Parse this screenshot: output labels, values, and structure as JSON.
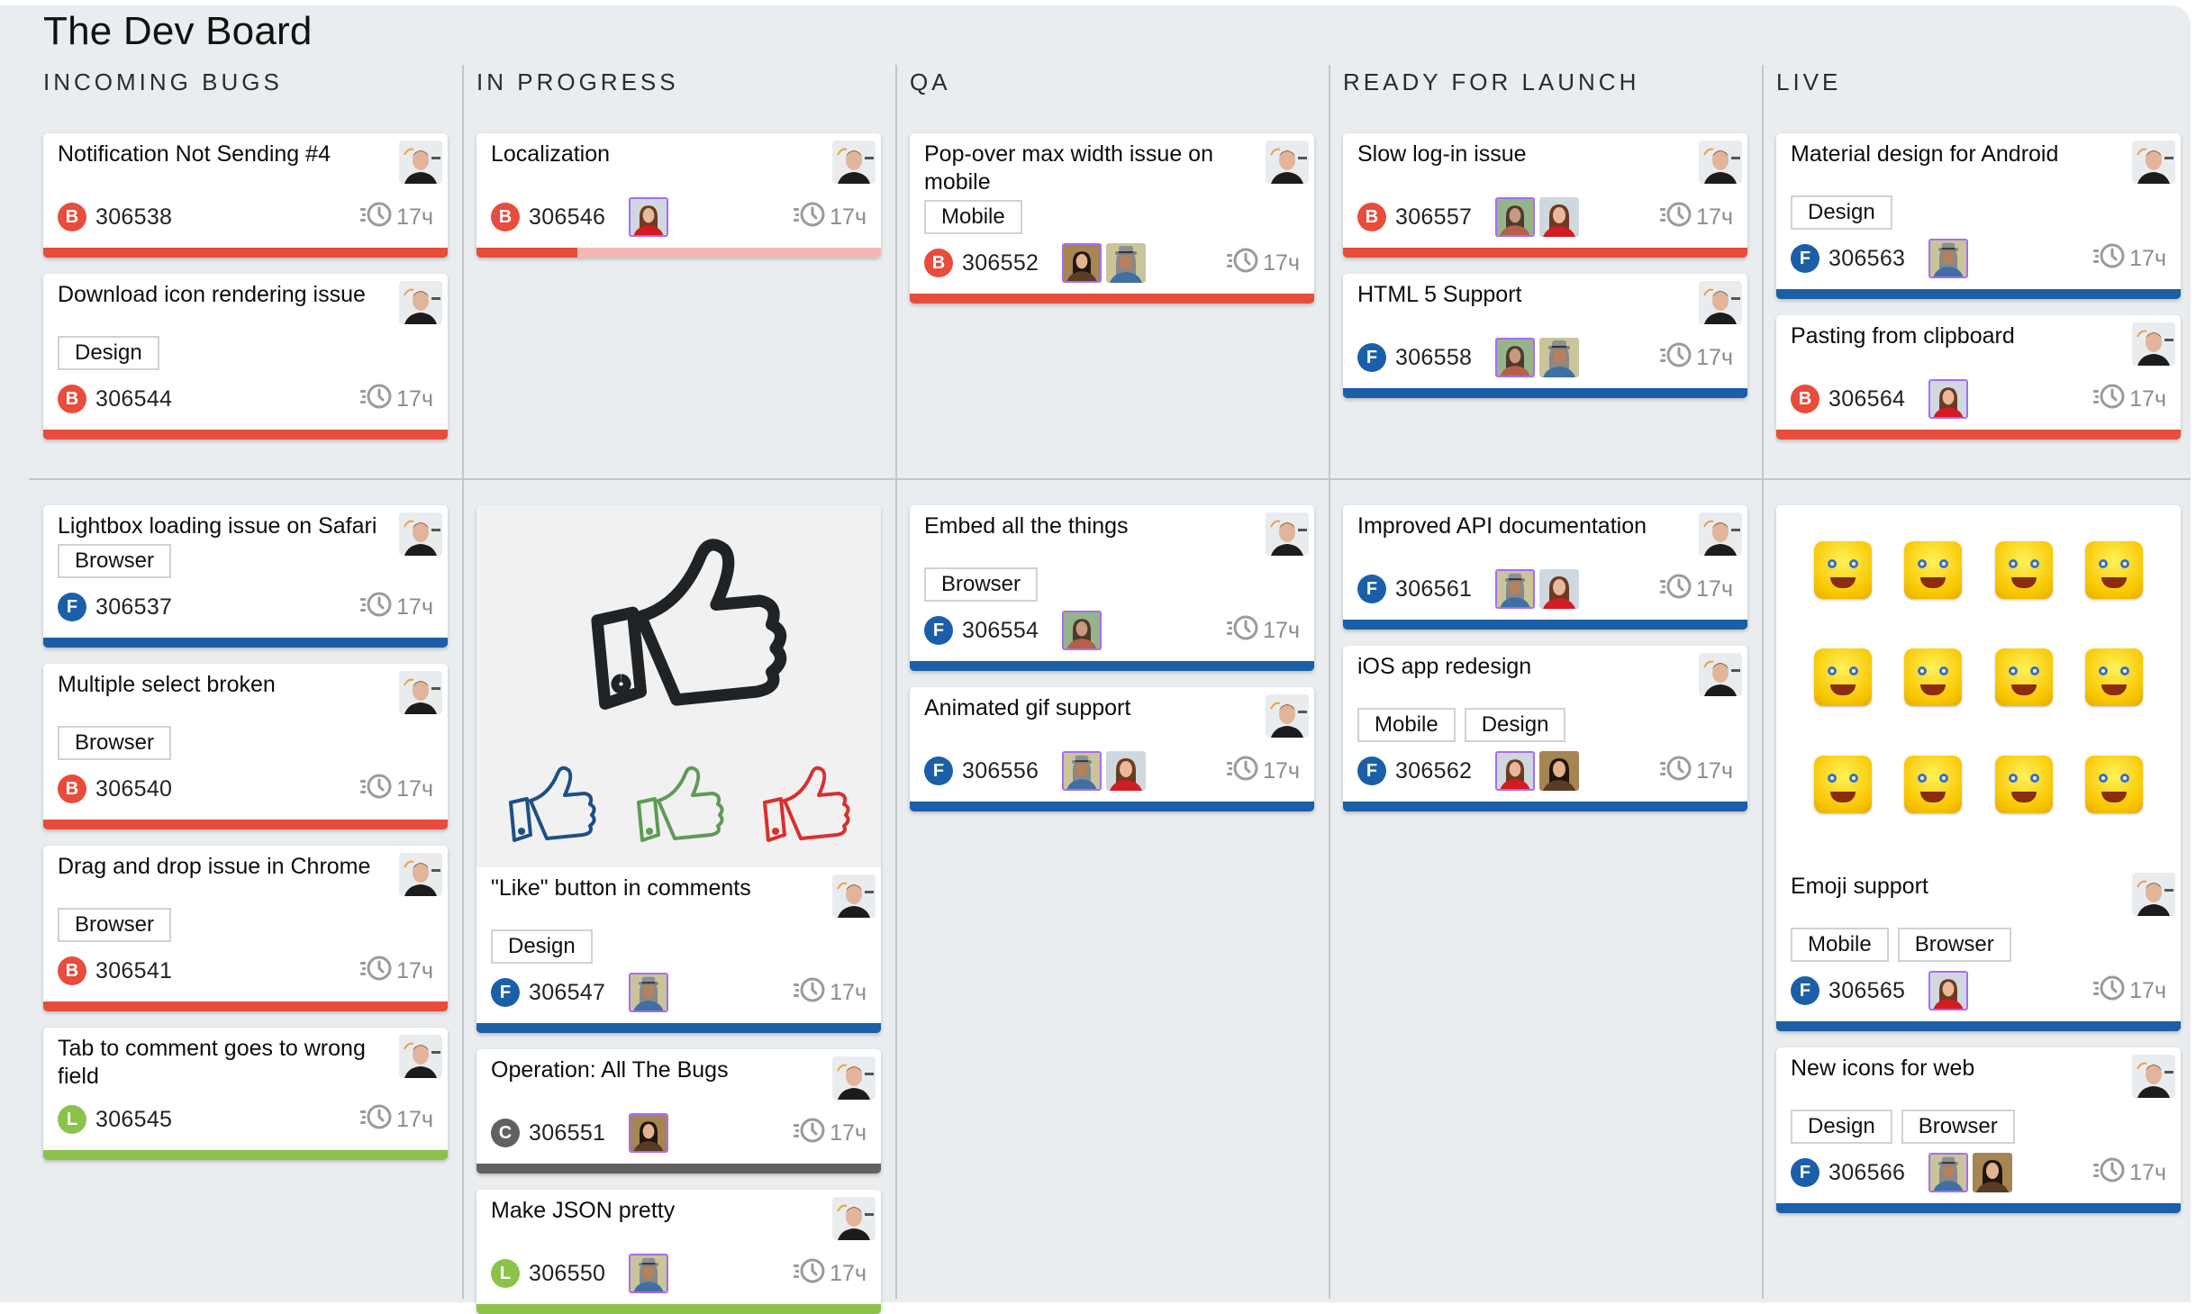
{
  "board": {
    "title": "The Dev Board",
    "colors": {
      "bug": "#e74c3c",
      "feature": "#1a5fa8",
      "chore": "#616161",
      "low": "#8bc34a",
      "progress_track_bug": "#f5b7b1",
      "member_highlight": "#a86cf5"
    }
  },
  "columns": [
    {
      "label": "INCOMING BUGS"
    },
    {
      "label": "IN PROGRESS"
    },
    {
      "label": "QA"
    },
    {
      "label": "READY FOR LAUNCH"
    },
    {
      "label": "LIVE"
    }
  ],
  "lanes": [
    {
      "columns": [
        [
          {
            "title": "Notification Not Sending #4",
            "tags": [],
            "type": "B",
            "type_color": "#e74c3c",
            "id": "306538",
            "members": [],
            "time": "17ч",
            "bar_color": "#e74c3c"
          },
          {
            "title": "Download icon rendering issue",
            "tags": [
              "Design"
            ],
            "type": "B",
            "type_color": "#e74c3c",
            "id": "306544",
            "members": [],
            "time": "17ч",
            "bar_color": "#e74c3c"
          }
        ],
        [
          {
            "title": "Localization",
            "tags": [],
            "type": "B",
            "type_color": "#e74c3c",
            "id": "306546",
            "members": [
              "woman-red"
            ],
            "time": "17ч",
            "bar_color": "#e74c3c",
            "progress": 0.25,
            "bar_track": "#f5b7b1"
          }
        ],
        [
          {
            "title": "Pop-over max width issue on mobile",
            "tags": [
              "Mobile"
            ],
            "type": "B",
            "type_color": "#e74c3c",
            "id": "306552",
            "members": [
              "woman-dark-hair",
              "man-hat"
            ],
            "time": "17ч",
            "bar_color": "#e74c3c"
          }
        ],
        [
          {
            "title": "Slow log-in issue",
            "tags": [],
            "type": "B",
            "type_color": "#e74c3c",
            "id": "306557",
            "members": [
              "woman-outdoor",
              "woman-red"
            ],
            "time": "17ч",
            "bar_color": "#e74c3c"
          },
          {
            "title": "HTML 5 Support",
            "tags": [],
            "type": "F",
            "type_color": "#1a5fa8",
            "id": "306558",
            "members": [
              "woman-outdoor",
              "man-hat"
            ],
            "time": "17ч",
            "bar_color": "#1a5fa8"
          }
        ],
        [
          {
            "title": "Material design for Android",
            "tags": [
              "Design"
            ],
            "type": "F",
            "type_color": "#1a5fa8",
            "id": "306563",
            "members": [
              "man-hat"
            ],
            "time": "17ч",
            "bar_color": "#1a5fa8"
          },
          {
            "title": "Pasting from clipboard",
            "tags": [],
            "type": "B",
            "type_color": "#e74c3c",
            "id": "306564",
            "members": [
              "woman-red"
            ],
            "time": "17ч",
            "bar_color": "#e74c3c"
          }
        ]
      ]
    },
    {
      "columns": [
        [
          {
            "title": "Lightbox loading issue on Safari",
            "tags": [
              "Browser"
            ],
            "type": "F",
            "type_color": "#1a5fa8",
            "id": "306537",
            "members": [],
            "time": "17ч",
            "bar_color": "#1a5fa8"
          },
          {
            "title": "Multiple select broken",
            "tags": [
              "Browser"
            ],
            "type": "B",
            "type_color": "#e74c3c",
            "id": "306540",
            "members": [],
            "time": "17ч",
            "bar_color": "#e74c3c"
          },
          {
            "title": "Drag and drop issue in Chrome",
            "tags": [
              "Browser"
            ],
            "type": "B",
            "type_color": "#e74c3c",
            "id": "306541",
            "members": [],
            "time": "17ч",
            "bar_color": "#e74c3c"
          },
          {
            "title": "Tab to comment goes to wrong field",
            "tags": [],
            "type": "L",
            "type_color": "#8bc34a",
            "id": "306545",
            "members": [],
            "time": "17ч",
            "bar_color": "#8bc34a"
          }
        ],
        [
          {
            "title": "\"Like\" button in comments",
            "cover": "thumbs-up",
            "tags": [
              "Design"
            ],
            "type": "F",
            "type_color": "#1a5fa8",
            "id": "306547",
            "members": [
              "man-hat"
            ],
            "time": "17ч",
            "bar_color": "#1a5fa8"
          },
          {
            "title": "Operation: All The Bugs",
            "tags": [],
            "type": "C",
            "type_color": "#616161",
            "id": "306551",
            "members": [
              "woman-dark-hair"
            ],
            "time": "17ч",
            "bar_color": "#616161"
          },
          {
            "title": "Make JSON pretty",
            "tags": [],
            "type": "L",
            "type_color": "#8bc34a",
            "id": "306550",
            "members": [
              "man-hat"
            ],
            "time": "17ч",
            "bar_color": "#8bc34a"
          }
        ],
        [
          {
            "title": "Embed all the things",
            "tags": [
              "Browser"
            ],
            "type": "F",
            "type_color": "#1a5fa8",
            "id": "306554",
            "members": [
              "woman-outdoor"
            ],
            "time": "17ч",
            "bar_color": "#1a5fa8"
          },
          {
            "title": "Animated gif support",
            "tags": [],
            "type": "F",
            "type_color": "#1a5fa8",
            "id": "306556",
            "members": [
              "man-hat",
              "woman-red"
            ],
            "time": "17ч",
            "bar_color": "#1a5fa8"
          }
        ],
        [
          {
            "title": "Improved API documentation",
            "tags": [],
            "type": "F",
            "type_color": "#1a5fa8",
            "id": "306561",
            "members": [
              "man-hat",
              "woman-red"
            ],
            "time": "17ч",
            "bar_color": "#1a5fa8"
          },
          {
            "title": "iOS app redesign",
            "tags": [
              "Mobile",
              "Design"
            ],
            "type": "F",
            "type_color": "#1a5fa8",
            "id": "306562",
            "members": [
              "woman-red",
              "woman-dark-hair"
            ],
            "time": "17ч",
            "bar_color": "#1a5fa8"
          }
        ],
        [
          {
            "title": "Emoji support",
            "cover": "emoji-grid",
            "tags": [
              "Mobile",
              "Browser"
            ],
            "type": "F",
            "type_color": "#1a5fa8",
            "id": "306565",
            "members": [
              "woman-red"
            ],
            "time": "17ч",
            "bar_color": "#1a5fa8"
          },
          {
            "title": "New icons for web",
            "tags": [
              "Design",
              "Browser"
            ],
            "type": "F",
            "type_color": "#1a5fa8",
            "id": "306566",
            "members": [
              "man-hat",
              "woman-dark-hair"
            ],
            "time": "17ч",
            "bar_color": "#1a5fa8"
          }
        ]
      ]
    }
  ],
  "icons": {
    "owner_avatar": "avatar-man-icon",
    "time": "timer-clock-icon"
  }
}
